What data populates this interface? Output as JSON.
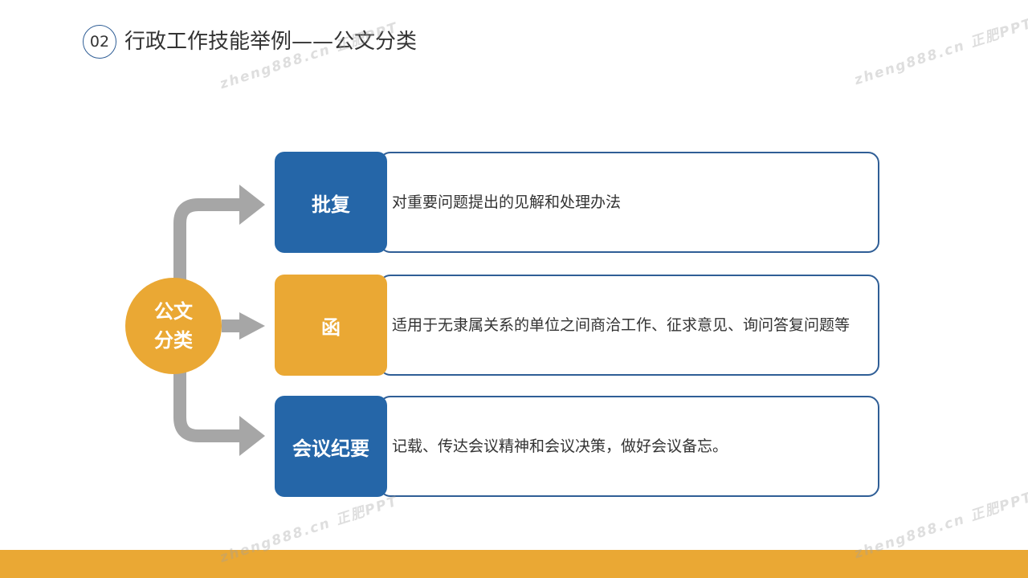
{
  "header": {
    "section_number": "02",
    "title": "行政工作技能举例——公文分类"
  },
  "hub": {
    "label_line1": "公文",
    "label_line2": "分类"
  },
  "items": [
    {
      "tag": "批复",
      "description": "对重要问题提出的见解和处理办法",
      "color": "#2566a8"
    },
    {
      "tag": "函",
      "description": "适用于无隶属关系的单位之间商洽工作、征求意见、询问答复问题等",
      "color": "#eaa834"
    },
    {
      "tag": "会议纪要",
      "description": "记载、传达会议精神和会议决策，做好会议备忘。",
      "color": "#2566a8"
    }
  ],
  "watermark": "zheng888.cn 正肥PPT",
  "colors": {
    "accent_blue": "#2566a8",
    "accent_orange": "#eaa834",
    "connector_gray": "#a6a6a6",
    "border_blue": "#2f5e96"
  }
}
